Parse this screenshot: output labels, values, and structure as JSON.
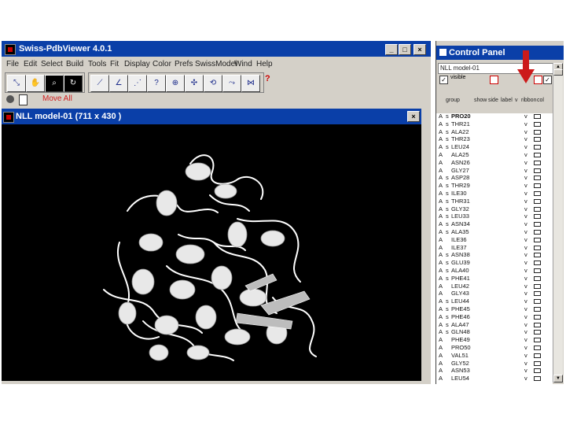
{
  "main_window": {
    "title": "Swiss-PdbViewer 4.0.1",
    "menu": [
      "File",
      "Edit",
      "Select",
      "Build",
      "Tools",
      "Fit",
      "Display",
      "Color",
      "Prefs",
      "SwissModel",
      "Wind",
      "Help"
    ],
    "status_mode": "Move All",
    "toolbar_help": "?"
  },
  "viewer": {
    "title": "NLL model-01  (711 x 430 )"
  },
  "control_panel": {
    "title": "Control Panel",
    "model_name": "NLL model-01",
    "visible_label": "visible",
    "columns": [
      "group",
      "show",
      "side",
      "label",
      "v",
      "ribbon",
      "col"
    ],
    "rows": [
      {
        "ch": "A",
        "ss": "s",
        "res": "PRO20",
        "sh": "v"
      },
      {
        "ch": "A",
        "ss": "s",
        "res": "THR21",
        "sh": "v"
      },
      {
        "ch": "A",
        "ss": "s",
        "res": "ALA22",
        "sh": "v"
      },
      {
        "ch": "A",
        "ss": "s",
        "res": "THR23",
        "sh": "v"
      },
      {
        "ch": "A",
        "ss": "s",
        "res": "LEU24",
        "sh": "v"
      },
      {
        "ch": "A",
        "ss": "",
        "res": "ALA25",
        "sh": "v"
      },
      {
        "ch": "A",
        "ss": "",
        "res": "ASN26",
        "sh": "v"
      },
      {
        "ch": "A",
        "ss": "",
        "res": "GLY27",
        "sh": "v"
      },
      {
        "ch": "A",
        "ss": "s",
        "res": "ASP28",
        "sh": "v"
      },
      {
        "ch": "A",
        "ss": "s",
        "res": "THR29",
        "sh": "v"
      },
      {
        "ch": "A",
        "ss": "s",
        "res": "ILE30",
        "sh": "v"
      },
      {
        "ch": "A",
        "ss": "s",
        "res": "THR31",
        "sh": "v"
      },
      {
        "ch": "A",
        "ss": "s",
        "res": "GLY32",
        "sh": "v"
      },
      {
        "ch": "A",
        "ss": "s",
        "res": "LEU33",
        "sh": "v"
      },
      {
        "ch": "A",
        "ss": "s",
        "res": "ASN34",
        "sh": "v"
      },
      {
        "ch": "A",
        "ss": "s",
        "res": "ALA35",
        "sh": "v"
      },
      {
        "ch": "A",
        "ss": "",
        "res": "ILE36",
        "sh": "v"
      },
      {
        "ch": "A",
        "ss": "",
        "res": "ILE37",
        "sh": "v"
      },
      {
        "ch": "A",
        "ss": "s",
        "res": "ASN38",
        "sh": "v"
      },
      {
        "ch": "A",
        "ss": "s",
        "res": "GLU39",
        "sh": "v"
      },
      {
        "ch": "A",
        "ss": "s",
        "res": "ALA40",
        "sh": "v"
      },
      {
        "ch": "A",
        "ss": "s",
        "res": "PHE41",
        "sh": "v"
      },
      {
        "ch": "A",
        "ss": "",
        "res": "LEU42",
        "sh": "v"
      },
      {
        "ch": "A",
        "ss": "",
        "res": "GLY43",
        "sh": "v"
      },
      {
        "ch": "A",
        "ss": "s",
        "res": "LEU44",
        "sh": "v"
      },
      {
        "ch": "A",
        "ss": "s",
        "res": "PHE45",
        "sh": "v"
      },
      {
        "ch": "A",
        "ss": "s",
        "res": "PHE46",
        "sh": "v"
      },
      {
        "ch": "A",
        "ss": "s",
        "res": "ALA47",
        "sh": "v"
      },
      {
        "ch": "A",
        "ss": "s",
        "res": "GLN48",
        "sh": "v"
      },
      {
        "ch": "A",
        "ss": "",
        "res": "PHE49",
        "sh": "v"
      },
      {
        "ch": "A",
        "ss": "",
        "res": "PRO50",
        "sh": "v"
      },
      {
        "ch": "A",
        "ss": "",
        "res": "VAL51",
        "sh": "v"
      },
      {
        "ch": "A",
        "ss": "",
        "res": "GLY52",
        "sh": "v"
      },
      {
        "ch": "A",
        "ss": "",
        "res": "ASN53",
        "sh": "v"
      },
      {
        "ch": "A",
        "ss": "",
        "res": "LEU54",
        "sh": "v"
      }
    ]
  },
  "colors": {
    "titlebar": "#0a3fa8",
    "viewer_bg": "#000000",
    "arrow": "#cc1a1a"
  }
}
